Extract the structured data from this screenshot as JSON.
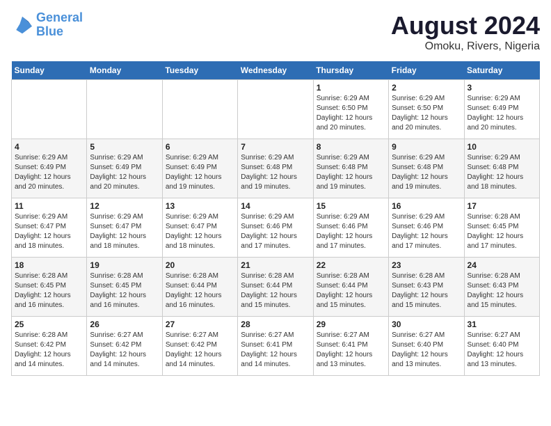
{
  "logo": {
    "text_general": "General",
    "text_blue": "Blue"
  },
  "title": "August 2024",
  "subtitle": "Omoku, Rivers, Nigeria",
  "days_of_week": [
    "Sunday",
    "Monday",
    "Tuesday",
    "Wednesday",
    "Thursday",
    "Friday",
    "Saturday"
  ],
  "weeks": [
    [
      {
        "day": "",
        "info": ""
      },
      {
        "day": "",
        "info": ""
      },
      {
        "day": "",
        "info": ""
      },
      {
        "day": "",
        "info": ""
      },
      {
        "day": "1",
        "info": "Sunrise: 6:29 AM\nSunset: 6:50 PM\nDaylight: 12 hours\nand 20 minutes."
      },
      {
        "day": "2",
        "info": "Sunrise: 6:29 AM\nSunset: 6:50 PM\nDaylight: 12 hours\nand 20 minutes."
      },
      {
        "day": "3",
        "info": "Sunrise: 6:29 AM\nSunset: 6:49 PM\nDaylight: 12 hours\nand 20 minutes."
      }
    ],
    [
      {
        "day": "4",
        "info": "Sunrise: 6:29 AM\nSunset: 6:49 PM\nDaylight: 12 hours\nand 20 minutes."
      },
      {
        "day": "5",
        "info": "Sunrise: 6:29 AM\nSunset: 6:49 PM\nDaylight: 12 hours\nand 20 minutes."
      },
      {
        "day": "6",
        "info": "Sunrise: 6:29 AM\nSunset: 6:49 PM\nDaylight: 12 hours\nand 19 minutes."
      },
      {
        "day": "7",
        "info": "Sunrise: 6:29 AM\nSunset: 6:48 PM\nDaylight: 12 hours\nand 19 minutes."
      },
      {
        "day": "8",
        "info": "Sunrise: 6:29 AM\nSunset: 6:48 PM\nDaylight: 12 hours\nand 19 minutes."
      },
      {
        "day": "9",
        "info": "Sunrise: 6:29 AM\nSunset: 6:48 PM\nDaylight: 12 hours\nand 19 minutes."
      },
      {
        "day": "10",
        "info": "Sunrise: 6:29 AM\nSunset: 6:48 PM\nDaylight: 12 hours\nand 18 minutes."
      }
    ],
    [
      {
        "day": "11",
        "info": "Sunrise: 6:29 AM\nSunset: 6:47 PM\nDaylight: 12 hours\nand 18 minutes."
      },
      {
        "day": "12",
        "info": "Sunrise: 6:29 AM\nSunset: 6:47 PM\nDaylight: 12 hours\nand 18 minutes."
      },
      {
        "day": "13",
        "info": "Sunrise: 6:29 AM\nSunset: 6:47 PM\nDaylight: 12 hours\nand 18 minutes."
      },
      {
        "day": "14",
        "info": "Sunrise: 6:29 AM\nSunset: 6:46 PM\nDaylight: 12 hours\nand 17 minutes."
      },
      {
        "day": "15",
        "info": "Sunrise: 6:29 AM\nSunset: 6:46 PM\nDaylight: 12 hours\nand 17 minutes."
      },
      {
        "day": "16",
        "info": "Sunrise: 6:29 AM\nSunset: 6:46 PM\nDaylight: 12 hours\nand 17 minutes."
      },
      {
        "day": "17",
        "info": "Sunrise: 6:28 AM\nSunset: 6:45 PM\nDaylight: 12 hours\nand 17 minutes."
      }
    ],
    [
      {
        "day": "18",
        "info": "Sunrise: 6:28 AM\nSunset: 6:45 PM\nDaylight: 12 hours\nand 16 minutes."
      },
      {
        "day": "19",
        "info": "Sunrise: 6:28 AM\nSunset: 6:45 PM\nDaylight: 12 hours\nand 16 minutes."
      },
      {
        "day": "20",
        "info": "Sunrise: 6:28 AM\nSunset: 6:44 PM\nDaylight: 12 hours\nand 16 minutes."
      },
      {
        "day": "21",
        "info": "Sunrise: 6:28 AM\nSunset: 6:44 PM\nDaylight: 12 hours\nand 15 minutes."
      },
      {
        "day": "22",
        "info": "Sunrise: 6:28 AM\nSunset: 6:44 PM\nDaylight: 12 hours\nand 15 minutes."
      },
      {
        "day": "23",
        "info": "Sunrise: 6:28 AM\nSunset: 6:43 PM\nDaylight: 12 hours\nand 15 minutes."
      },
      {
        "day": "24",
        "info": "Sunrise: 6:28 AM\nSunset: 6:43 PM\nDaylight: 12 hours\nand 15 minutes."
      }
    ],
    [
      {
        "day": "25",
        "info": "Sunrise: 6:28 AM\nSunset: 6:42 PM\nDaylight: 12 hours\nand 14 minutes."
      },
      {
        "day": "26",
        "info": "Sunrise: 6:27 AM\nSunset: 6:42 PM\nDaylight: 12 hours\nand 14 minutes."
      },
      {
        "day": "27",
        "info": "Sunrise: 6:27 AM\nSunset: 6:42 PM\nDaylight: 12 hours\nand 14 minutes."
      },
      {
        "day": "28",
        "info": "Sunrise: 6:27 AM\nSunset: 6:41 PM\nDaylight: 12 hours\nand 14 minutes."
      },
      {
        "day": "29",
        "info": "Sunrise: 6:27 AM\nSunset: 6:41 PM\nDaylight: 12 hours\nand 13 minutes."
      },
      {
        "day": "30",
        "info": "Sunrise: 6:27 AM\nSunset: 6:40 PM\nDaylight: 12 hours\nand 13 minutes."
      },
      {
        "day": "31",
        "info": "Sunrise: 6:27 AM\nSunset: 6:40 PM\nDaylight: 12 hours\nand 13 minutes."
      }
    ]
  ]
}
